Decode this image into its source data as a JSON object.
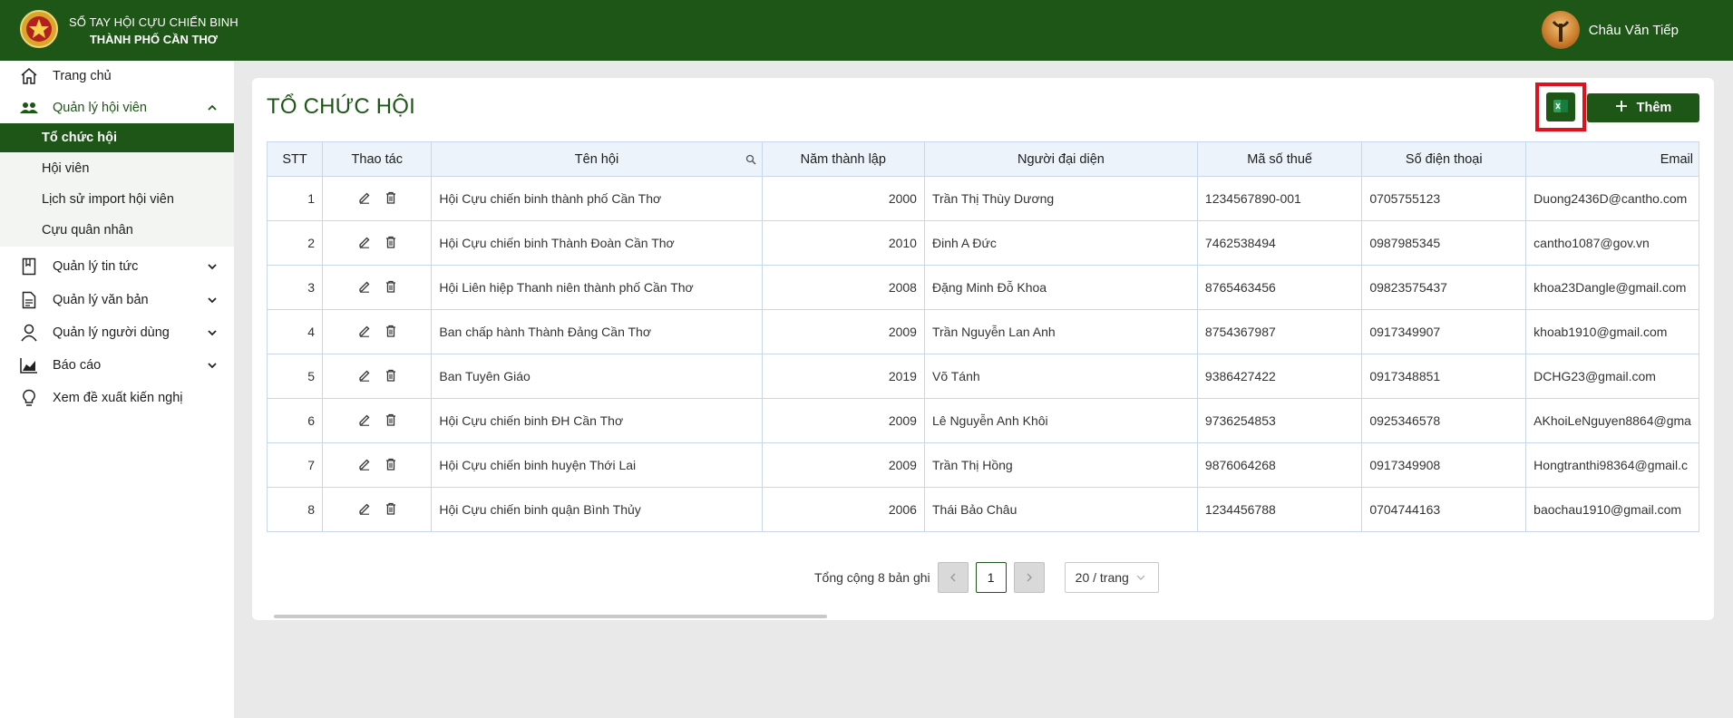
{
  "header": {
    "brand_line1": "SỔ TAY HỘI CỰU CHIẾN BINH",
    "brand_line2": "THÀNH PHỐ CẦN THƠ",
    "user_name": "Châu Văn Tiếp"
  },
  "sidebar": {
    "home": "Trang chủ",
    "members_group": "Quản lý hội viên",
    "sub_items": [
      "Tổ chức hội",
      "Hội viên",
      "Lịch sử import hội viên",
      "Cựu quân nhân"
    ],
    "news": "Quản lý tin tức",
    "docs": "Quản lý văn bản",
    "users": "Quản lý người dùng",
    "reports": "Báo cáo",
    "proposals": "Xem đề xuất kiến nghị"
  },
  "page": {
    "title": "TỔ CHỨC HỘI",
    "add_label": "Thêm"
  },
  "table": {
    "headers": {
      "stt": "STT",
      "actions": "Thao tác",
      "name": "Tên hội",
      "year": "Năm thành lập",
      "rep": "Người đại diện",
      "tax": "Mã số thuế",
      "phone": "Số điện thoại",
      "email": "Email"
    },
    "rows": [
      {
        "stt": "1",
        "name": "Hội Cựu chiến binh thành phố Cần Thơ",
        "year": "2000",
        "rep": "Trần Thị Thùy Dương",
        "tax": "1234567890-001",
        "phone": "0705755123",
        "email": "Duong2436D@cantho.com"
      },
      {
        "stt": "2",
        "name": "Hội Cựu chiến binh Thành Đoàn Cần Thơ",
        "year": "2010",
        "rep": "Đinh A Đức",
        "tax": "7462538494",
        "phone": "0987985345",
        "email": "cantho1087@gov.vn"
      },
      {
        "stt": "3",
        "name": "Hội Liên hiệp Thanh niên thành phố Cần Thơ",
        "year": "2008",
        "rep": "Đặng Minh Đỗ Khoa",
        "tax": "8765463456",
        "phone": "09823575437",
        "email": "khoa23Dangle@gmail.com"
      },
      {
        "stt": "4",
        "name": "Ban chấp hành Thành Đảng Cần Thơ",
        "year": "2009",
        "rep": "Trần Nguyễn Lan Anh",
        "tax": "8754367987",
        "phone": "0917349907",
        "email": "khoab1910@gmail.com"
      },
      {
        "stt": "5",
        "name": "Ban Tuyên Giáo",
        "year": "2019",
        "rep": "Võ Tánh",
        "tax": "9386427422",
        "phone": "0917348851",
        "email": "DCHG23@gmail.com"
      },
      {
        "stt": "6",
        "name": "Hội Cựu chiến binh ĐH Cần Thơ",
        "year": "2009",
        "rep": "Lê Nguyễn Anh Khôi",
        "tax": "9736254853",
        "phone": "0925346578",
        "email": "AKhoiLeNguyen8864@gma"
      },
      {
        "stt": "7",
        "name": "Hội Cựu chiến binh huyện Thới Lai",
        "year": "2009",
        "rep": "Trần Thị Hồng",
        "tax": "9876064268",
        "phone": "0917349908",
        "email": "Hongtranthi98364@gmail.c"
      },
      {
        "stt": "8",
        "name": "Hội Cựu chiến binh quận Bình Thủy",
        "year": "2006",
        "rep": "Thái Bảo Châu",
        "tax": "1234456788",
        "phone": "0704744163",
        "email": "baochau1910@gmail.com"
      }
    ]
  },
  "pagination": {
    "total": "Tổng cộng 8 bản ghi",
    "current": "1",
    "page_size": "20 / trang"
  },
  "colors": {
    "primary": "#1e5617",
    "highlight": "#e0101e"
  }
}
